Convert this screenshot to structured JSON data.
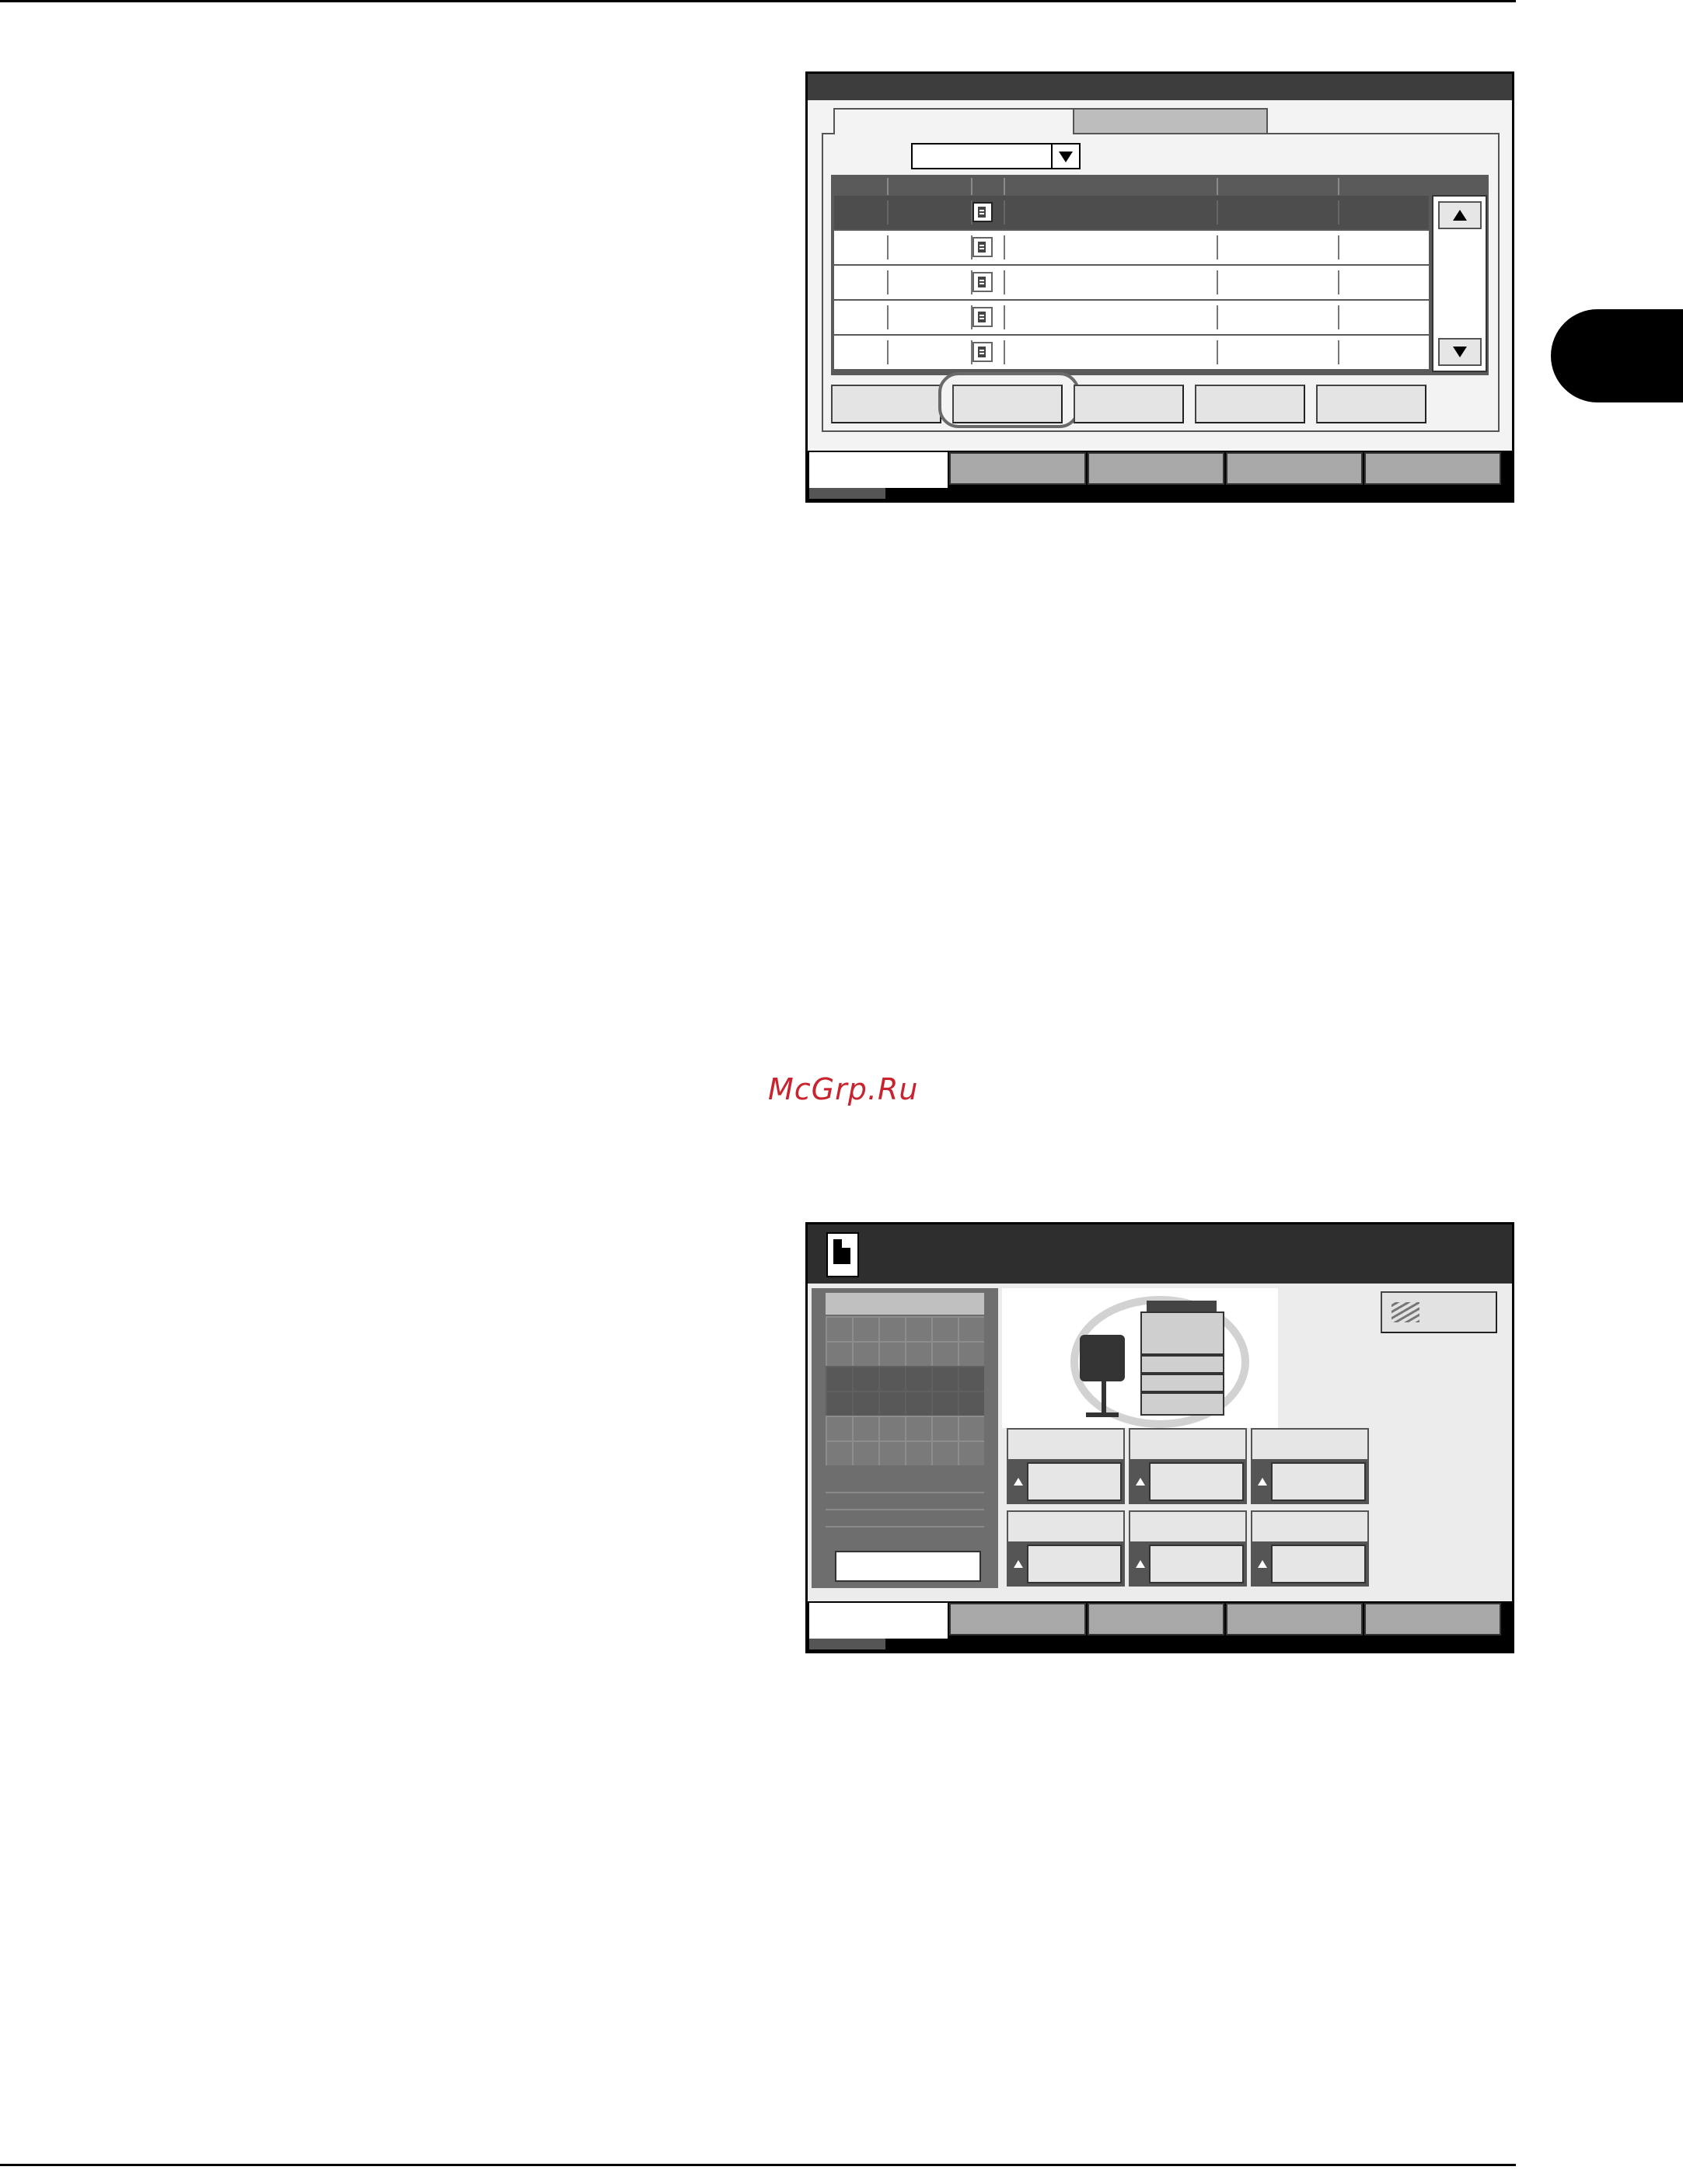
{
  "page": {
    "watermark": "McGrp.Ru"
  },
  "panel1": {
    "title": "",
    "tabs": [
      "",
      ""
    ],
    "dropdown_value": "",
    "list_rows": 5,
    "selected_row": 1,
    "action_buttons": [
      "",
      "",
      "",
      "",
      ""
    ],
    "highlighted_button": 2,
    "bottom_tabs": [
      "",
      "",
      "",
      "",
      ""
    ],
    "active_bottom_tab": 1
  },
  "panel2": {
    "title": "",
    "left_button": "",
    "right_button": "",
    "trays": [
      "",
      "",
      "",
      "",
      "",
      ""
    ],
    "bottom_tabs": [
      "",
      "",
      "",
      "",
      ""
    ],
    "active_bottom_tab": 1
  }
}
